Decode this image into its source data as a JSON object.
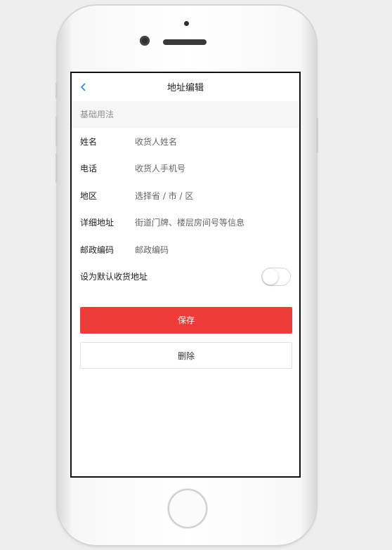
{
  "nav": {
    "back_icon": "chevron-left-icon",
    "title": "地址编辑"
  },
  "section": {
    "title": "基础用法"
  },
  "form": {
    "fields": [
      {
        "label": "姓名",
        "placeholder": "收货人姓名"
      },
      {
        "label": "电话",
        "placeholder": "收货人手机号"
      },
      {
        "label": "地区",
        "placeholder": "选择省 / 市 / 区"
      },
      {
        "label": "详细地址",
        "placeholder": "街道门牌、楼层房间号等信息"
      },
      {
        "label": "邮政编码",
        "placeholder": "邮政编码"
      }
    ],
    "default_switch": {
      "label": "设为默认收货地址",
      "on": false
    }
  },
  "actions": {
    "save_label": "保存",
    "delete_label": "删除"
  },
  "colors": {
    "accent": "#f03b3b",
    "back_icon": "#1e88e5"
  }
}
